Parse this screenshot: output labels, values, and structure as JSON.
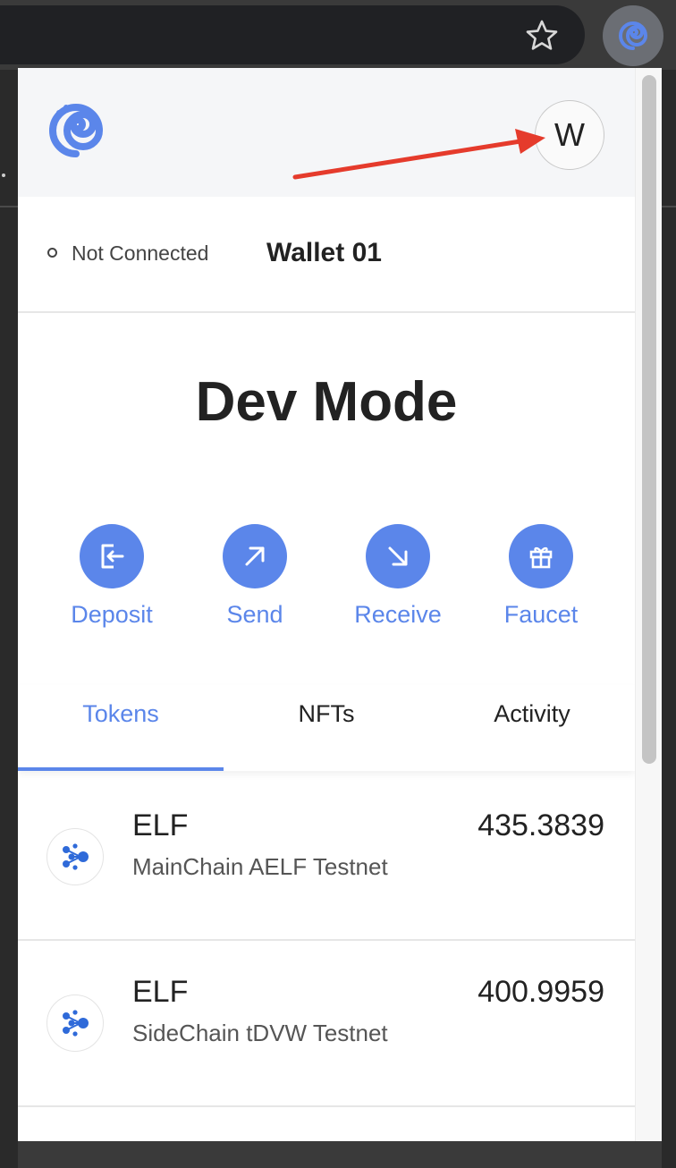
{
  "browser": {
    "star_icon": "star-outline-icon",
    "extension_icon": "swirl-logo-icon"
  },
  "header": {
    "logo_icon": "swirl-logo-icon",
    "avatar_letter": "W"
  },
  "wallet": {
    "status": "Not Connected",
    "name": "Wallet 01"
  },
  "mode_title": "Dev Mode",
  "actions": [
    {
      "label": "Deposit",
      "icon": "deposit-icon"
    },
    {
      "label": "Send",
      "icon": "arrow-up-right-icon"
    },
    {
      "label": "Receive",
      "icon": "arrow-down-right-icon"
    },
    {
      "label": "Faucet",
      "icon": "gift-icon"
    }
  ],
  "tabs": [
    {
      "label": "Tokens",
      "active": true
    },
    {
      "label": "NFTs",
      "active": false
    },
    {
      "label": "Activity",
      "active": false
    }
  ],
  "tokens": [
    {
      "symbol": "ELF",
      "chain": "MainChain AELF Testnet",
      "balance": "435.3839"
    },
    {
      "symbol": "ELF",
      "chain": "SideChain tDVW Testnet",
      "balance": "400.9959"
    }
  ],
  "colors": {
    "accent": "#5b86ea",
    "annotation_arrow": "#e53b2c"
  }
}
